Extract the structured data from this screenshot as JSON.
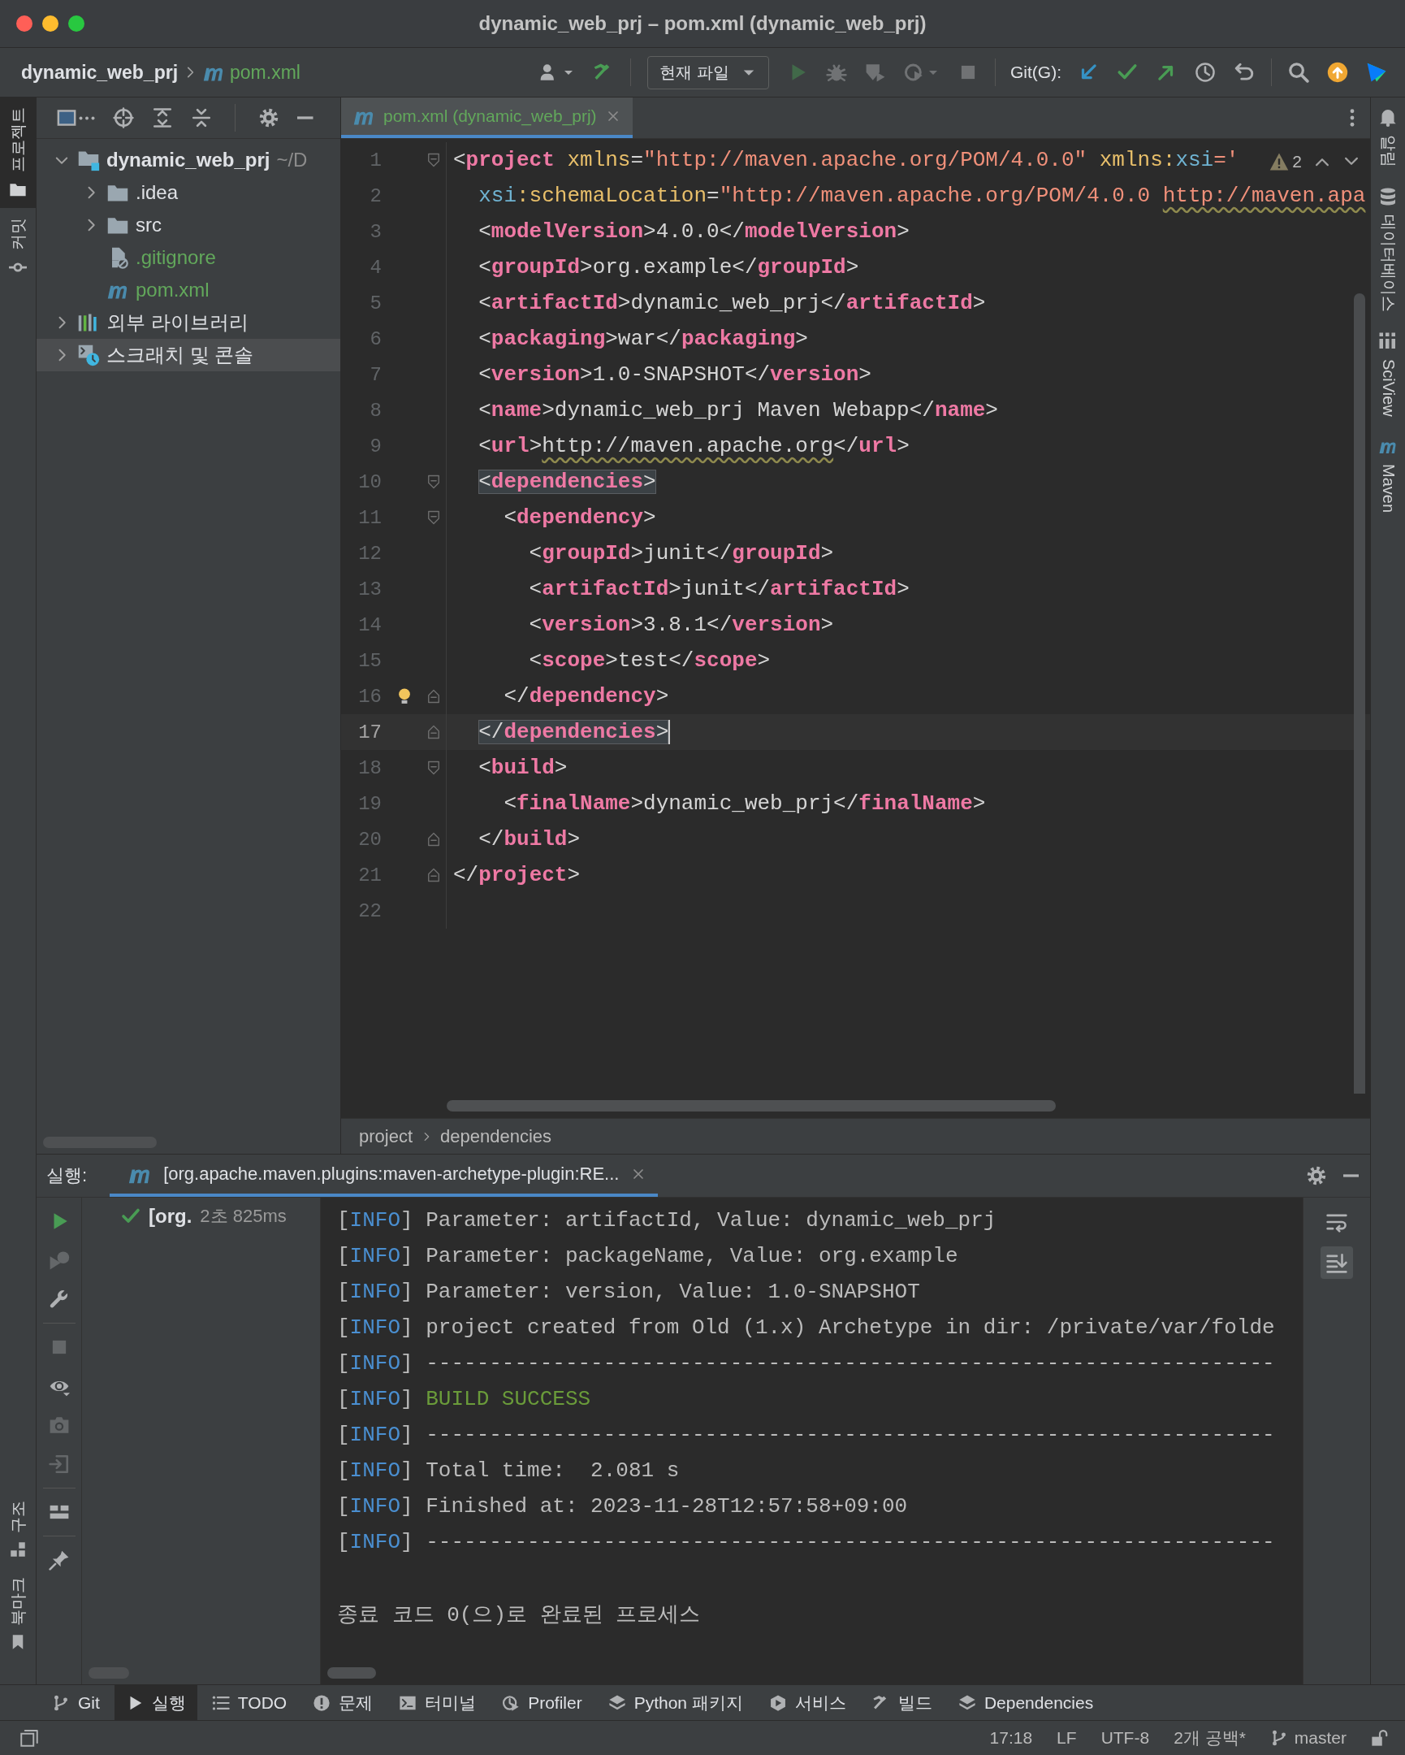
{
  "window": {
    "title": "dynamic_web_prj – pom.xml (dynamic_web_prj)"
  },
  "navbar": {
    "breadcrumb": [
      {
        "kind": "project",
        "label": "dynamic_web_prj"
      },
      {
        "kind": "maven",
        "label": "pom.xml"
      }
    ],
    "actions_left": [
      {
        "kind": "user",
        "dropdown": true,
        "disabled": false
      },
      {
        "kind": "build",
        "dropdown": false,
        "disabled": false
      }
    ],
    "run_config": "현재 파일",
    "run_actions": [
      {
        "kind": "run",
        "dropdown": false,
        "disabled": true
      },
      {
        "kind": "debug",
        "dropdown": false,
        "disabled": true
      },
      {
        "kind": "coverage",
        "dropdown": false,
        "disabled": true
      },
      {
        "kind": "profile",
        "dropdown": true,
        "disabled": true
      },
      {
        "kind": "stop",
        "dropdown": false,
        "disabled": true
      }
    ],
    "git_label": "Git(G):",
    "git_actions": [
      {
        "kind": "update",
        "disabled": false
      },
      {
        "kind": "commit",
        "disabled": false
      },
      {
        "kind": "push",
        "disabled": false
      },
      {
        "kind": "history",
        "disabled": false
      },
      {
        "kind": "rollback",
        "disabled": false
      }
    ],
    "actions_right": [
      {
        "kind": "search",
        "disabled": false
      },
      {
        "kind": "updates",
        "disabled": false
      },
      {
        "kind": "toolbox",
        "disabled": false
      }
    ]
  },
  "left_stripe": {
    "top": [
      {
        "kind": "project",
        "label": "프로젝트",
        "selected": true
      },
      {
        "kind": "commit",
        "label": "커밋",
        "selected": false
      }
    ],
    "bottom": [
      {
        "kind": "structure",
        "label": "구조",
        "selected": false
      },
      {
        "kind": "bookmarks",
        "label": "북마크",
        "selected": false
      }
    ]
  },
  "right_stripe": [
    {
      "kind": "notifications",
      "label": "알림"
    },
    {
      "kind": "database",
      "label": "데이터베이스"
    },
    {
      "kind": "sciview",
      "label": "SciView"
    },
    {
      "kind": "maven",
      "label": "Maven"
    }
  ],
  "project_panel": {
    "tools": [
      {
        "kind": "view"
      },
      {
        "kind": "locate"
      },
      {
        "kind": "expand"
      },
      {
        "kind": "collapse"
      },
      {
        "kind": "settings"
      },
      {
        "kind": "hide"
      }
    ],
    "tree": [
      {
        "kind": "module",
        "label": "dynamic_web_prj",
        "path": "~/D",
        "expanded": true,
        "selected": false,
        "children": [
          {
            "kind": "folder",
            "label": ".idea",
            "expanded": false,
            "selected": false
          },
          {
            "kind": "folder",
            "label": "src",
            "expanded": false,
            "selected": false
          },
          {
            "kind": "ignore-file",
            "label": ".gitignore",
            "selected": false
          },
          {
            "kind": "maven",
            "label": "pom.xml",
            "selected": false
          }
        ]
      },
      {
        "kind": "libraries",
        "label": "외부 라이브러리",
        "expanded": false,
        "selected": false
      },
      {
        "kind": "scratches",
        "label": "스크래치 및 콘솔",
        "expanded": false,
        "selected": true
      }
    ]
  },
  "editor": {
    "tab": {
      "label": "pom.xml (dynamic_web_prj)",
      "selected": true
    },
    "warnings": "2",
    "lines": [
      {
        "number": "1",
        "fold": {
          "kind": "open"
        },
        "current": false,
        "matched": false,
        "bulb": false,
        "tokens": [
          {
            "kind": "punct",
            "text": "<"
          },
          {
            "kind": "tag",
            "text": "project"
          },
          {
            "kind": "attr",
            "text": " xmlns"
          },
          {
            "kind": "punct",
            "text": "="
          },
          {
            "kind": "value",
            "text": "\"http://maven.apache.org/POM/4.0.0\""
          },
          {
            "kind": "attr",
            "text": " xmlns:"
          },
          {
            "kind": "ns",
            "text": "xsi"
          },
          {
            "kind": "value",
            "text": "='"
          }
        ]
      },
      {
        "number": "2",
        "current": false,
        "matched": false,
        "bulb": false,
        "tokens": [
          {
            "kind": "ns",
            "text": "  xsi"
          },
          {
            "kind": "attr",
            "text": ":schemaLocation"
          },
          {
            "kind": "punct",
            "text": "="
          },
          {
            "kind": "value",
            "text": "\"http://maven.apache.org/POM/4.0.0 "
          },
          {
            "kind": "value-link",
            "text": "http://maven.apa"
          }
        ]
      },
      {
        "number": "3",
        "current": false,
        "matched": false,
        "bulb": false,
        "tokens": [
          {
            "kind": "punct",
            "text": "  <"
          },
          {
            "kind": "tag",
            "text": "modelVersion"
          },
          {
            "kind": "punct",
            "text": ">"
          },
          {
            "kind": "text",
            "text": "4.0.0"
          },
          {
            "kind": "punct",
            "text": "</"
          },
          {
            "kind": "tag",
            "text": "modelVersion"
          },
          {
            "kind": "punct",
            "text": ">"
          }
        ]
      },
      {
        "number": "4",
        "current": false,
        "matched": false,
        "bulb": false,
        "tokens": [
          {
            "kind": "punct",
            "text": "  <"
          },
          {
            "kind": "tag",
            "text": "groupId"
          },
          {
            "kind": "punct",
            "text": ">"
          },
          {
            "kind": "text",
            "text": "org.example"
          },
          {
            "kind": "punct",
            "text": "</"
          },
          {
            "kind": "tag",
            "text": "groupId"
          },
          {
            "kind": "punct",
            "text": ">"
          }
        ]
      },
      {
        "number": "5",
        "current": false,
        "matched": false,
        "bulb": false,
        "tokens": [
          {
            "kind": "punct",
            "text": "  <"
          },
          {
            "kind": "tag",
            "text": "artifactId"
          },
          {
            "kind": "punct",
            "text": ">"
          },
          {
            "kind": "text",
            "text": "dynamic_web_prj"
          },
          {
            "kind": "punct",
            "text": "</"
          },
          {
            "kind": "tag",
            "text": "artifactId"
          },
          {
            "kind": "punct",
            "text": ">"
          }
        ]
      },
      {
        "number": "6",
        "current": false,
        "matched": false,
        "bulb": false,
        "tokens": [
          {
            "kind": "punct",
            "text": "  <"
          },
          {
            "kind": "tag",
            "text": "packaging"
          },
          {
            "kind": "punct",
            "text": ">"
          },
          {
            "kind": "text",
            "text": "war"
          },
          {
            "kind": "punct",
            "text": "</"
          },
          {
            "kind": "tag",
            "text": "packaging"
          },
          {
            "kind": "punct",
            "text": ">"
          }
        ]
      },
      {
        "number": "7",
        "current": false,
        "matched": false,
        "bulb": false,
        "tokens": [
          {
            "kind": "punct",
            "text": "  <"
          },
          {
            "kind": "tag",
            "text": "version"
          },
          {
            "kind": "punct",
            "text": ">"
          },
          {
            "kind": "text",
            "text": "1.0-SNAPSHOT"
          },
          {
            "kind": "punct",
            "text": "</"
          },
          {
            "kind": "tag",
            "text": "version"
          },
          {
            "kind": "punct",
            "text": ">"
          }
        ]
      },
      {
        "number": "8",
        "current": false,
        "matched": false,
        "bulb": false,
        "tokens": [
          {
            "kind": "punct",
            "text": "  <"
          },
          {
            "kind": "tag",
            "text": "name"
          },
          {
            "kind": "punct",
            "text": ">"
          },
          {
            "kind": "text",
            "text": "dynamic_web_prj Maven Webapp"
          },
          {
            "kind": "punct",
            "text": "</"
          },
          {
            "kind": "tag",
            "text": "name"
          },
          {
            "kind": "punct",
            "text": ">"
          }
        ]
      },
      {
        "number": "9",
        "current": false,
        "matched": false,
        "bulb": false,
        "tokens": [
          {
            "kind": "punct",
            "text": "  <"
          },
          {
            "kind": "tag",
            "text": "url"
          },
          {
            "kind": "punct",
            "text": ">"
          },
          {
            "kind": "text-link",
            "text": "http://maven.apache.org"
          },
          {
            "kind": "punct",
            "text": "</"
          },
          {
            "kind": "tag",
            "text": "url"
          },
          {
            "kind": "punct",
            "text": ">"
          }
        ]
      },
      {
        "number": "10",
        "fold": {
          "kind": "open"
        },
        "current": false,
        "matched": true,
        "bulb": false,
        "tokens": [
          {
            "kind": "punct",
            "text": "  <"
          },
          {
            "kind": "tag",
            "text": "dependencies"
          },
          {
            "kind": "punct",
            "text": ">"
          }
        ]
      },
      {
        "number": "11",
        "fold": {
          "kind": "open"
        },
        "current": false,
        "matched": false,
        "bulb": false,
        "tokens": [
          {
            "kind": "punct",
            "text": "    <"
          },
          {
            "kind": "tag",
            "text": "dependency"
          },
          {
            "kind": "punct",
            "text": ">"
          }
        ]
      },
      {
        "number": "12",
        "current": false,
        "matched": false,
        "bulb": false,
        "tokens": [
          {
            "kind": "punct",
            "text": "      <"
          },
          {
            "kind": "tag",
            "text": "groupId"
          },
          {
            "kind": "punct",
            "text": ">"
          },
          {
            "kind": "text",
            "text": "junit"
          },
          {
            "kind": "punct",
            "text": "</"
          },
          {
            "kind": "tag",
            "text": "groupId"
          },
          {
            "kind": "punct",
            "text": ">"
          }
        ]
      },
      {
        "number": "13",
        "current": false,
        "matched": false,
        "bulb": false,
        "tokens": [
          {
            "kind": "punct",
            "text": "      <"
          },
          {
            "kind": "tag",
            "text": "artifactId"
          },
          {
            "kind": "punct",
            "text": ">"
          },
          {
            "kind": "text",
            "text": "junit"
          },
          {
            "kind": "punct",
            "text": "</"
          },
          {
            "kind": "tag",
            "text": "artifactId"
          },
          {
            "kind": "punct",
            "text": ">"
          }
        ]
      },
      {
        "number": "14",
        "current": false,
        "matched": false,
        "bulb": false,
        "tokens": [
          {
            "kind": "punct",
            "text": "      <"
          },
          {
            "kind": "tag",
            "text": "version"
          },
          {
            "kind": "punct",
            "text": ">"
          },
          {
            "kind": "text",
            "text": "3.8.1"
          },
          {
            "kind": "punct",
            "text": "</"
          },
          {
            "kind": "tag",
            "text": "version"
          },
          {
            "kind": "punct",
            "text": ">"
          }
        ]
      },
      {
        "number": "15",
        "current": false,
        "matched": false,
        "bulb": false,
        "tokens": [
          {
            "kind": "punct",
            "text": "      <"
          },
          {
            "kind": "tag",
            "text": "scope"
          },
          {
            "kind": "punct",
            "text": ">"
          },
          {
            "kind": "text",
            "text": "test"
          },
          {
            "kind": "punct",
            "text": "</"
          },
          {
            "kind": "tag",
            "text": "scope"
          },
          {
            "kind": "punct",
            "text": ">"
          }
        ]
      },
      {
        "number": "16",
        "fold": {
          "kind": "close"
        },
        "current": false,
        "matched": false,
        "bulb": true,
        "tokens": [
          {
            "kind": "punct",
            "text": "    </"
          },
          {
            "kind": "tag",
            "text": "dependency"
          },
          {
            "kind": "punct",
            "text": ">"
          }
        ]
      },
      {
        "number": "17",
        "fold": {
          "kind": "close"
        },
        "current": true,
        "matched": true,
        "bulb": false,
        "tokens": [
          {
            "kind": "punct",
            "text": "  </"
          },
          {
            "kind": "tag",
            "text": "dependencies"
          },
          {
            "kind": "punct",
            "text": ">"
          }
        ]
      },
      {
        "number": "18",
        "fold": {
          "kind": "open"
        },
        "current": false,
        "matched": false,
        "bulb": false,
        "tokens": [
          {
            "kind": "punct",
            "text": "  <"
          },
          {
            "kind": "tag",
            "text": "build"
          },
          {
            "kind": "punct",
            "text": ">"
          }
        ]
      },
      {
        "number": "19",
        "current": false,
        "matched": false,
        "bulb": false,
        "tokens": [
          {
            "kind": "punct",
            "text": "    <"
          },
          {
            "kind": "tag",
            "text": "finalName"
          },
          {
            "kind": "punct",
            "text": ">"
          },
          {
            "kind": "text",
            "text": "dynamic_web_prj"
          },
          {
            "kind": "punct",
            "text": "</"
          },
          {
            "kind": "tag",
            "text": "finalName"
          },
          {
            "kind": "punct",
            "text": ">"
          }
        ]
      },
      {
        "number": "20",
        "fold": {
          "kind": "close"
        },
        "current": false,
        "matched": false,
        "bulb": false,
        "tokens": [
          {
            "kind": "punct",
            "text": "  </"
          },
          {
            "kind": "tag",
            "text": "build"
          },
          {
            "kind": "punct",
            "text": ">"
          }
        ]
      },
      {
        "number": "21",
        "fold": {
          "kind": "close"
        },
        "current": false,
        "matched": false,
        "bulb": false,
        "tokens": [
          {
            "kind": "punct",
            "text": "</"
          },
          {
            "kind": "tag",
            "text": "project"
          },
          {
            "kind": "punct",
            "text": ">"
          }
        ]
      },
      {
        "number": "22",
        "current": false,
        "bulb": false
      }
    ],
    "breadcrumb": [
      "project",
      "dependencies"
    ]
  },
  "run_panel": {
    "label": "실행:",
    "tab": {
      "label": "[org.apache.maven.plugins:maven-archetype-plugin:RE...",
      "selected": true
    },
    "toolbar": [
      {
        "kind": "rerun",
        "disabled": false
      },
      {
        "kind": "rerun-failed",
        "disabled": true
      },
      {
        "kind": "settings",
        "disabled": false
      },
      {
        "kind": "separator"
      },
      {
        "kind": "stop",
        "disabled": true
      },
      {
        "kind": "view",
        "disabled": false
      },
      {
        "kind": "snapshot",
        "disabled": true
      },
      {
        "kind": "import",
        "disabled": true
      },
      {
        "kind": "separator"
      },
      {
        "kind": "layout",
        "disabled": false
      },
      {
        "kind": "separator"
      },
      {
        "kind": "pin",
        "disabled": false
      }
    ],
    "tree": {
      "kind": "success",
      "name": "[org.",
      "duration": "2초 825ms"
    },
    "console": [
      {
        "kind": "plain",
        "open": "[",
        "level": "INFO",
        "close": "]",
        "text": "Parameter: artifactId, Value: dynamic_web_prj"
      },
      {
        "kind": "plain",
        "open": "[",
        "level": "INFO",
        "close": "]",
        "text": "Parameter: packageName, Value: org.example"
      },
      {
        "kind": "plain",
        "open": "[",
        "level": "INFO",
        "close": "]",
        "text": "Parameter: version, Value: 1.0-SNAPSHOT"
      },
      {
        "kind": "plain",
        "open": "[",
        "level": "INFO",
        "close": "]",
        "text": "project created from Old (1.x) Archetype in dir: /private/var/folde"
      },
      {
        "kind": "plain",
        "open": "[",
        "level": "INFO",
        "close": "]",
        "text": "-------------------------------------------------------------------"
      },
      {
        "kind": "success",
        "open": "[",
        "level": "INFO",
        "close": "]",
        "text": "BUILD SUCCESS"
      },
      {
        "kind": "plain",
        "open": "[",
        "level": "INFO",
        "close": "]",
        "text": "-------------------------------------------------------------------"
      },
      {
        "kind": "plain",
        "open": "[",
        "level": "INFO",
        "close": "]",
        "text": "Total time:  2.081 s"
      },
      {
        "kind": "plain",
        "open": "[",
        "level": "INFO",
        "close": "]",
        "text": "Finished at: 2023-11-28T12:57:58+09:00"
      },
      {
        "kind": "plain",
        "open": "[",
        "level": "INFO",
        "close": "]",
        "text": "-------------------------------------------------------------------"
      }
    ],
    "exit_message": "종료 코드 0(으)로 완료된 프로세스",
    "console_tools": [
      {
        "kind": "soft-wrap",
        "selected": false
      },
      {
        "kind": "scroll-to-end",
        "selected": true
      }
    ]
  },
  "tool_windows": [
    {
      "kind": "git",
      "label": "Git",
      "selected": false
    },
    {
      "kind": "run",
      "label": "실행",
      "selected": true
    },
    {
      "kind": "todo",
      "label": "TODO",
      "selected": false
    },
    {
      "kind": "problems",
      "label": "문제",
      "selected": false
    },
    {
      "kind": "terminal",
      "label": "터미널",
      "selected": false
    },
    {
      "kind": "profiler",
      "label": "Profiler",
      "selected": false
    },
    {
      "kind": "packages",
      "label": "Python 패키지",
      "selected": false
    },
    {
      "kind": "services",
      "label": "서비스",
      "selected": false
    },
    {
      "kind": "build",
      "label": "빌드",
      "selected": false
    },
    {
      "kind": "dependencies",
      "label": "Dependencies",
      "selected": false
    }
  ],
  "status_bar": {
    "items": [
      "17:18",
      "LF",
      "UTF-8",
      "2개 공백*"
    ],
    "branch": "master"
  }
}
